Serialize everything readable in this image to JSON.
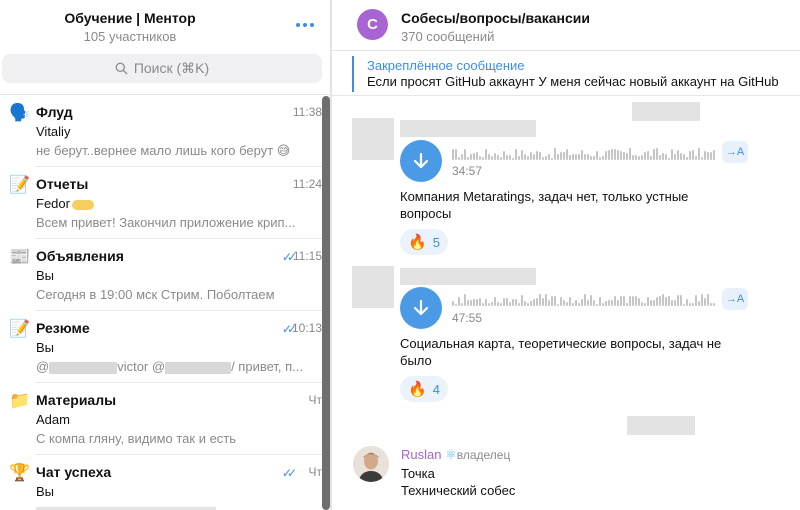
{
  "left": {
    "group_title": "Обучение | Ментор",
    "group_subtitle": "105 участников",
    "search_placeholder": "Поиск (⌘K)",
    "chats": [
      {
        "emoji": "🗣️",
        "name": "Флуд",
        "time": "11:38",
        "sender": "Vitaliy",
        "preview": "не берут..вернее мало лишь кого берут 😅",
        "read": false
      },
      {
        "emoji": "📝",
        "name": "Отчеты",
        "time": "11:24",
        "sender": "Fedor",
        "preview": "Всем привет! Закончил приложение крип...",
        "read": false
      },
      {
        "emoji": "📰",
        "name": "Объявления",
        "time": "11:15",
        "sender": "Вы",
        "preview": "Сегодня в 19:00 мск Стрим. Поболтаем",
        "read": true
      },
      {
        "emoji": "📝",
        "name": "Резюме",
        "time": "10:13",
        "sender": "Вы",
        "preview_a": "@",
        "preview_b": "victor @",
        "preview_c": "/ привет, п...",
        "read": true
      },
      {
        "emoji": "📁",
        "name": "Материалы",
        "time": "Чт",
        "sender": "Adam",
        "preview": "С компа гляну, видимо так и есть",
        "read": false
      },
      {
        "emoji": "🏆",
        "name": "Чат успеха",
        "time": "Чт",
        "sender": "Вы",
        "preview": "",
        "read": true
      }
    ]
  },
  "right": {
    "channel_initial": "С",
    "channel_title": "Собесы/вопросы/вакансии",
    "channel_subtitle": "370 сообщений",
    "pinned_title": "Закреплённое сообщение",
    "pinned_text": "Если просят GitHub аккаунт  У меня сейчас новый аккаунт на GitHub",
    "messages": [
      {
        "duration": "34:57",
        "text": "Компания Metaratings, задач нет, только устные вопросы",
        "reaction_count": "5"
      },
      {
        "duration": "47:55",
        "text": "Социальная карта, теоретические вопросы, задач не было",
        "reaction_count": "4"
      }
    ],
    "last_message": {
      "sender": "Ruslan",
      "role": "владелец",
      "line1": "Точка",
      "line2": "Технический собес"
    },
    "transcribe_label": "→A"
  },
  "colors": {
    "accent": "#3a8ee6",
    "channel_avatar": "#a864d2",
    "voice_button": "#4b9ae6"
  }
}
